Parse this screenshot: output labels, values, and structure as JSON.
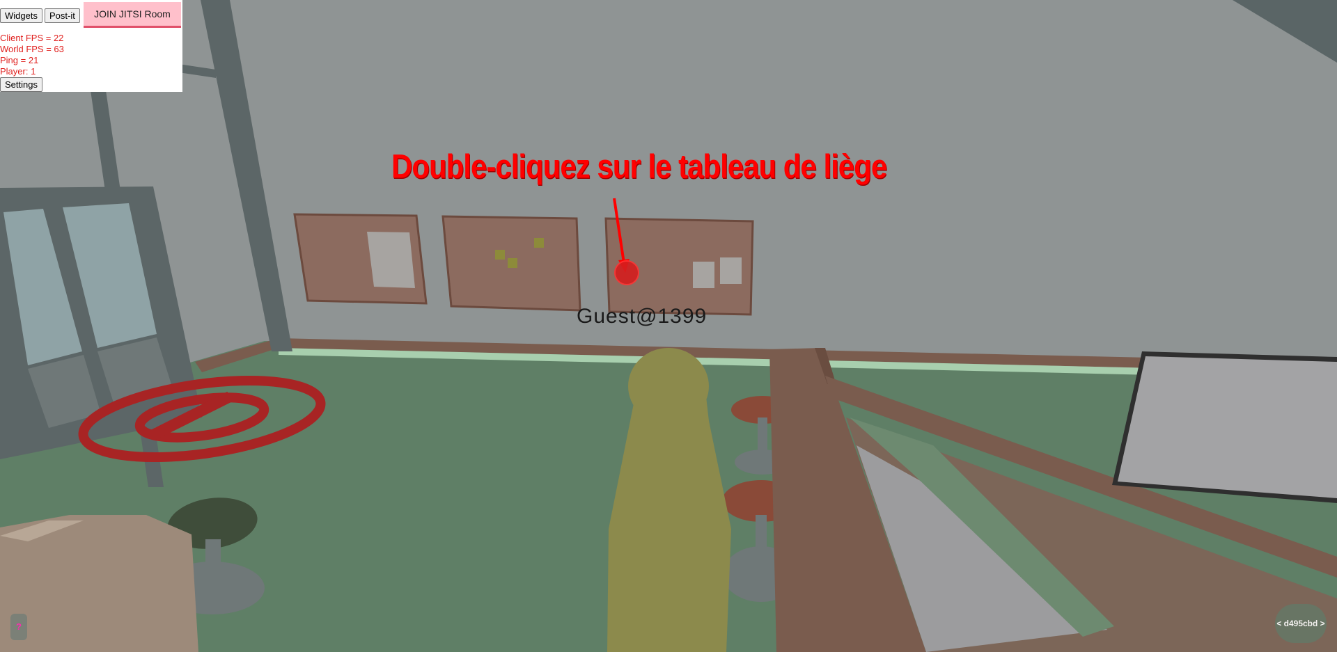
{
  "toolbar": {
    "widgets_label": "Widgets",
    "postit_label": "Post-it",
    "jitsi_label": "JOIN JITSI Room"
  },
  "stats": {
    "client_fps": "Client FPS = 22",
    "world_fps": "World FPS = 63",
    "ping": "Ping = 21",
    "players": "Player: 1"
  },
  "settings_label": "Settings",
  "instruction_text": "Double-cliquez sur le tableau de liège",
  "player_name": "Guest@1399",
  "help_label": "?",
  "session_label": "< d495cbd >",
  "colors": {
    "wall": "#8f9494",
    "floor": "#5f7f66",
    "corkboard": "#8c6b5f",
    "avatar": "#8c8a4c",
    "accent_red": "#ff0000"
  }
}
